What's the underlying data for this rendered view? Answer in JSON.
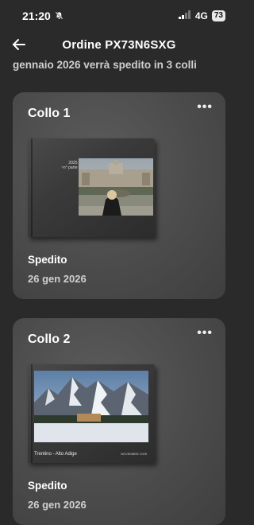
{
  "status_bar": {
    "time": "21:20",
    "network": "4G",
    "battery": "73"
  },
  "header": {
    "title": "Ordine PX73N6SXG"
  },
  "subtitle": "gennaio 2026 verrà spedito in 3 colli",
  "packages": [
    {
      "title": "Collo 1",
      "status": "Spedito",
      "date": "26 gen 2026",
      "book_text_line1": "2025",
      "book_text_line2": "~n° parte"
    },
    {
      "title": "Collo 2",
      "status": "Spedito",
      "date": "26 gen 2026",
      "book_caption": "Trentino - Alto Adige",
      "book_caption_right": "NOVEMBRE 2025"
    }
  ],
  "icons": {
    "back": "arrow-left-icon",
    "more": "ellipsis-icon",
    "mute": "bell-slash-icon",
    "signal": "signal-icon"
  }
}
